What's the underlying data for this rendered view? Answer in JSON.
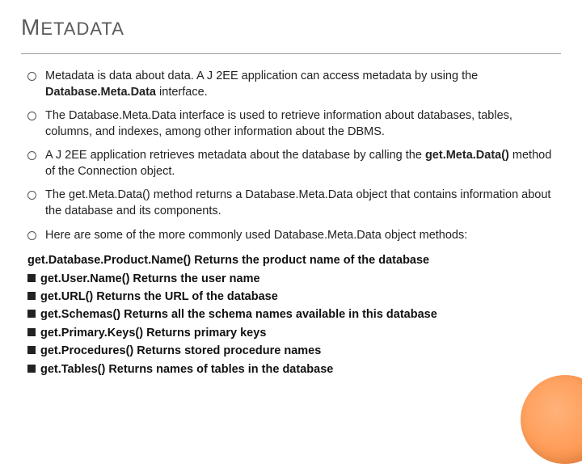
{
  "title": "METADATA",
  "bullets": [
    {
      "pre": "Metadata is data about data. A J 2EE application can access metadata by using the ",
      "b": "Database.Meta.Data",
      "post": " interface."
    },
    {
      "pre": "The Database.Meta.Data interface is used to retrieve information about databases, tables, columns, and indexes, among other information about the DBMS.",
      "b": "",
      "post": ""
    },
    {
      "pre": "A J 2EE application retrieves metadata about the database by calling the ",
      "b": "get.Meta.Data()",
      "post": " method of the Connection object."
    },
    {
      "pre": "The get.Meta.Data() method returns a Database.Meta.Data object that contains information about the database and its components.",
      "b": "",
      "post": ""
    },
    {
      "pre": "Here are some of the more commonly used Database.Meta.Data object methods:",
      "b": "",
      "post": ""
    }
  ],
  "methods_lead": "get.Database.Product.Name() Returns the product name of the database",
  "methods": [
    "get.User.Name() Returns the user name",
    "get.URL() Returns the URL of the database",
    "get.Schemas() Returns all the schema names available in this database",
    "get.Primary.Keys() Returns primary keys",
    "get.Procedures() Returns stored procedure names",
    "get.Tables() Returns names of tables in the database"
  ]
}
